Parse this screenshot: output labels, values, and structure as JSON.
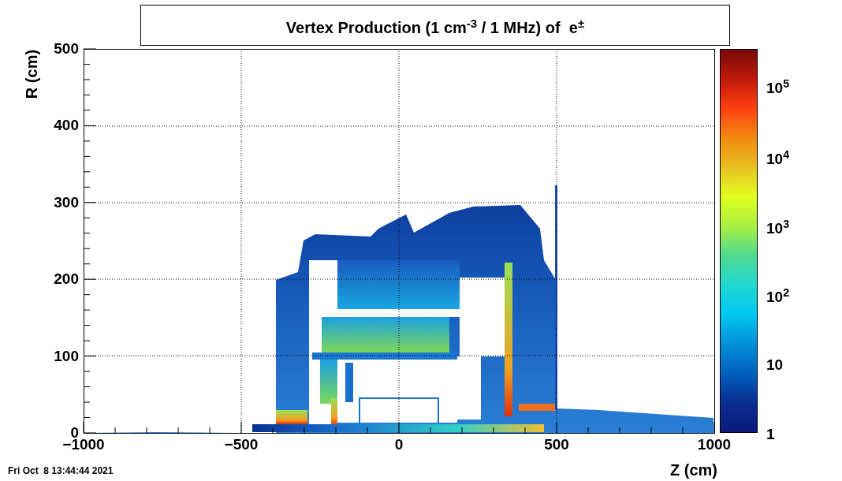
{
  "title": "Vertex Production (1 cm$^{-3}$ / 1 MHz) of  e$^{±}$",
  "y_axis": {
    "label": "R (cm)",
    "ticks": [
      "500",
      "400",
      "300",
      "200",
      "100",
      "0"
    ]
  },
  "x_axis": {
    "label": "Z (cm)",
    "ticks": [
      "−1000",
      "−500",
      "0",
      "500",
      "1000"
    ]
  },
  "color_scale": {
    "ticks": [
      "10$^{5}$",
      "10$^{4}$",
      "10$^{3}$",
      "10$^{2}$",
      "10",
      "1"
    ]
  },
  "timestamp": "Fri Oct  8 13:44:44 2021"
}
